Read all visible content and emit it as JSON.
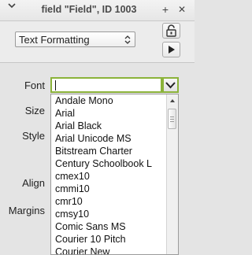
{
  "window": {
    "title": "field \"Field\", ID 1003",
    "add_symbol": "+",
    "close_symbol": "✕"
  },
  "toolbar": {
    "mode_selected": "Text Formatting"
  },
  "labels": {
    "font": "Font",
    "size": "Size",
    "style": "Style",
    "align": "Align",
    "margins": "Margins"
  },
  "font_field": {
    "value": ""
  },
  "font_list": [
    "Andale Mono",
    "Arial",
    "Arial Black",
    "Arial Unicode MS",
    "Bitstream Charter",
    "Century Schoolbook L",
    "cmex10",
    "cmmi10",
    "cmr10",
    "cmsy10",
    "Comic Sans MS",
    "Courier 10 Pitch",
    "Courier New"
  ],
  "colors": {
    "focus_accent": "#8bb33a"
  }
}
